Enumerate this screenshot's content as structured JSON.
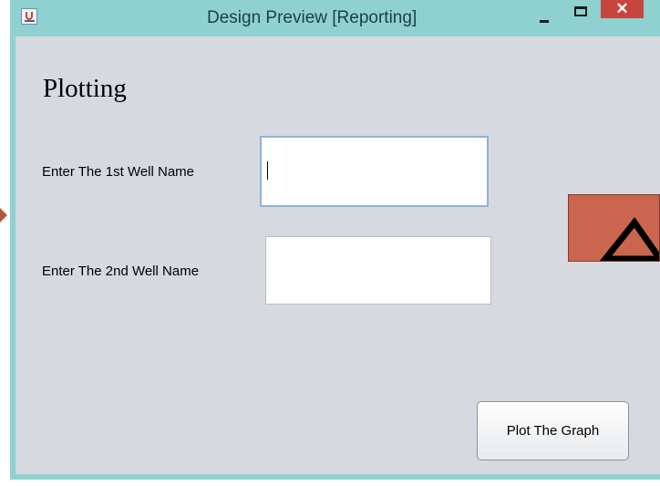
{
  "window": {
    "title": "Design Preview [Reporting]",
    "close_glyph": "✕",
    "icons": [
      "java-app-icon",
      "minimize-icon",
      "maximize-icon",
      "close-icon"
    ]
  },
  "form": {
    "heading": "Plotting",
    "well1_label": "Enter The 1st Well Name",
    "well1_value": "",
    "well2_label": "Enter The 2nd Well Name",
    "well2_value": "",
    "submit_label": "Plot The Graph"
  },
  "colors": {
    "titlebar": "#8fd1d0",
    "content_bg": "#d6d9e0",
    "close_button": "#c7453c",
    "accent_shape": "#c9664d"
  }
}
